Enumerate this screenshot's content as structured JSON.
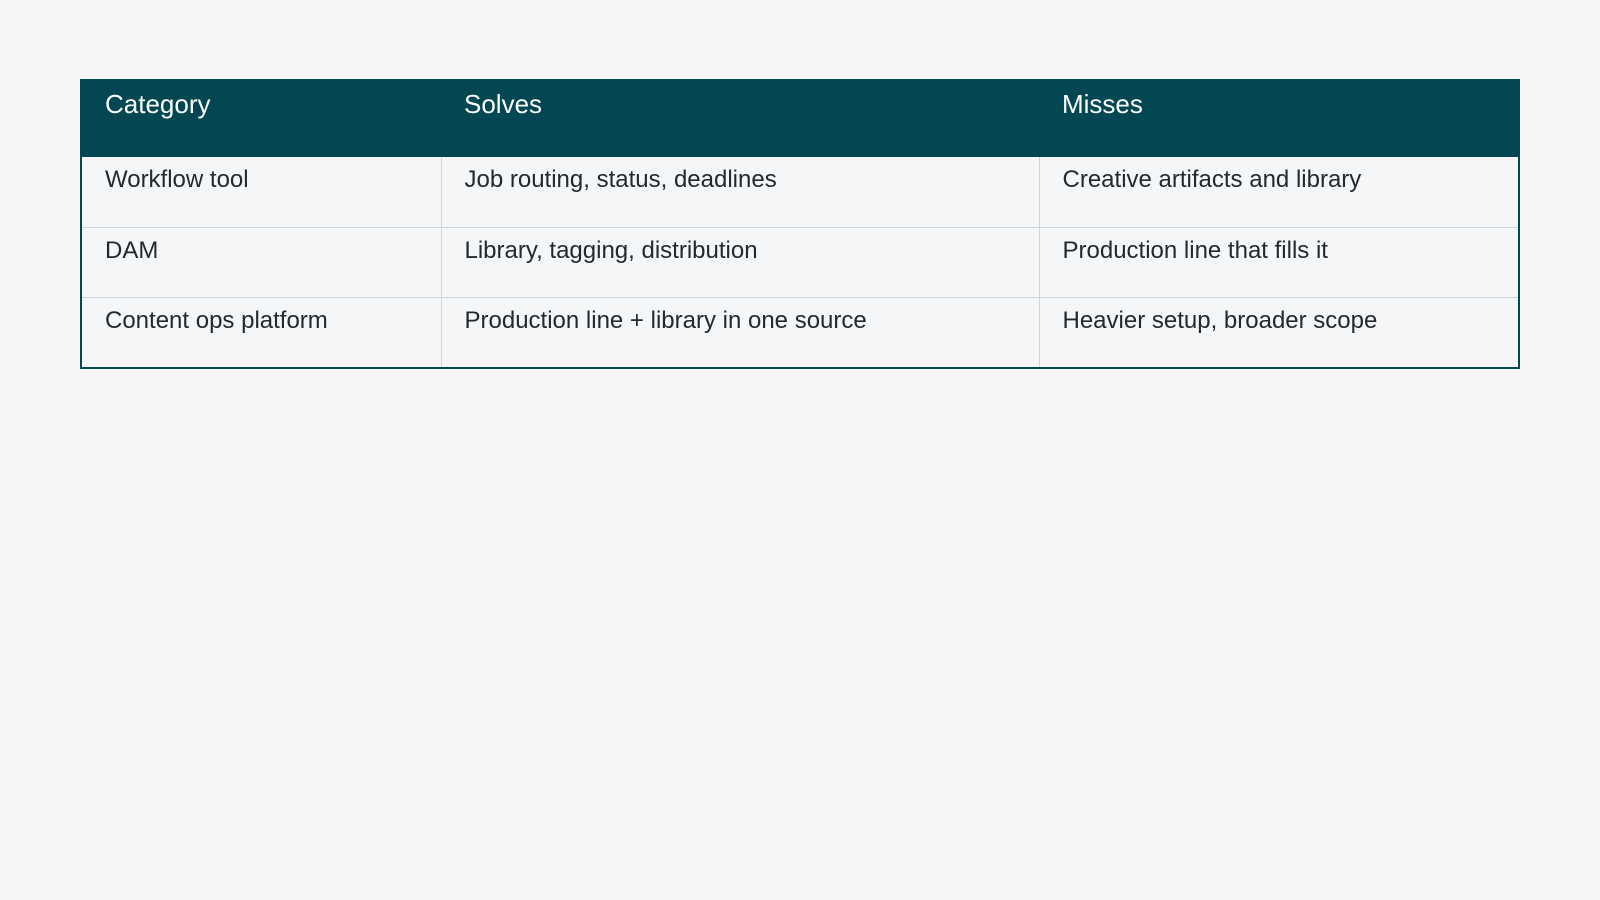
{
  "table": {
    "headers": [
      "Category",
      "Solves",
      "Misses"
    ],
    "rows": [
      [
        "Workflow tool",
        "Job routing, status, deadlines",
        "Creative artifacts and library"
      ],
      [
        "DAM",
        "Library, tagging, distribution",
        "Production line that fills it"
      ],
      [
        "Content ops platform",
        "Production line + library in one source",
        "Heavier setup, broader scope"
      ]
    ]
  },
  "colors": {
    "header_bg": "#024752",
    "header_text": "#ffffff",
    "page_bg": "#f4f6f8",
    "body_text": "#222a2e",
    "grid_line": "#cfd4d8"
  }
}
